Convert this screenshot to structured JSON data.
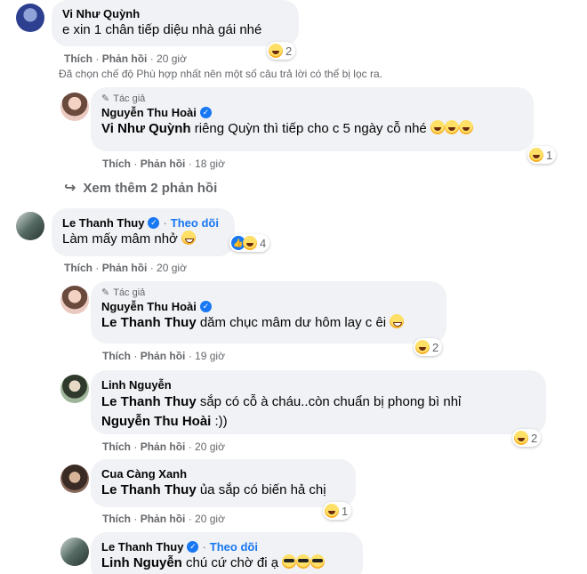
{
  "actions": {
    "like": "Thích",
    "reply": "Phản hồi",
    "sep": "·"
  },
  "author_tag": "Tác giả",
  "follow": "Theo dõi",
  "filter_notice": "Đã chọn chế độ Phù hợp nhất nên một số câu trả lời có thể bị lọc ra.",
  "see_more": "Xem thêm 2 phản hồi",
  "comments": [
    {
      "author": "Vi Như Quỳnh",
      "text": "e xin 1 chân tiếp diệu nhà gái nhé",
      "time": "20 giờ",
      "reactions": "2"
    },
    {
      "author": "Nguyễn Thu Hoài",
      "mention": "Vi Như Quỳnh",
      "text": " riêng Quỳn thì tiếp cho c 5 ngày cỗ nhé",
      "time": "18 giờ",
      "reactions": "1"
    },
    {
      "author": "Le Thanh Thuy",
      "text": "Làm mấy mâm nhở",
      "time": "20 giờ",
      "reactions": "4"
    },
    {
      "author": "Nguyễn Thu Hoài",
      "mention": "Le Thanh Thuy",
      "text": " dăm chục mâm dư hôm lay c êi",
      "time": "19 giờ",
      "reactions": "2"
    },
    {
      "author": "Linh Nguyễn",
      "mention": "Le Thanh Thuy",
      "text": " sắp có cỗ à cháu..còn chuẩn bị phong bì nhỉ",
      "mention2": "Nguyễn Thu Hoài",
      "text2": " :))",
      "time": "20 giờ",
      "reactions": "2"
    },
    {
      "author": "Cua Càng Xanh",
      "mention": "Le Thanh Thuy",
      "text": " ủa sắp có biến hả chị",
      "time": "20 giờ",
      "reactions": "1"
    },
    {
      "author": "Le Thanh Thuy",
      "mention": "Linh Nguyễn",
      "text": " chú cứ chờ đi ạ"
    }
  ]
}
